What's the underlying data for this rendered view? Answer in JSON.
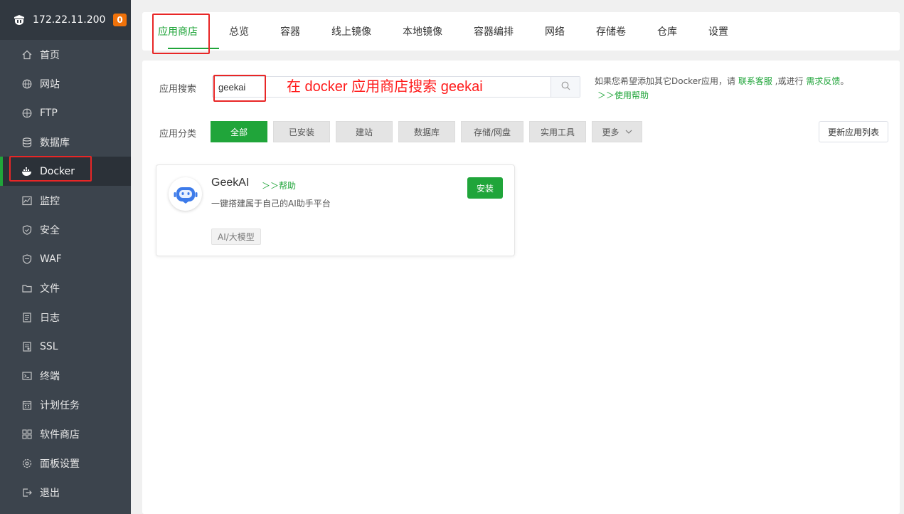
{
  "sidebar": {
    "ip": "172.22.11.200",
    "badge": "0",
    "items": [
      {
        "label": "首页",
        "icon": "home-icon"
      },
      {
        "label": "网站",
        "icon": "globe-icon"
      },
      {
        "label": "FTP",
        "icon": "ftp-icon"
      },
      {
        "label": "数据库",
        "icon": "database-icon"
      },
      {
        "label": "Docker",
        "icon": "docker-icon"
      },
      {
        "label": "监控",
        "icon": "monitor-icon"
      },
      {
        "label": "安全",
        "icon": "shield-icon"
      },
      {
        "label": "WAF",
        "icon": "waf-icon"
      },
      {
        "label": "文件",
        "icon": "folder-icon"
      },
      {
        "label": "日志",
        "icon": "log-icon"
      },
      {
        "label": "SSL",
        "icon": "ssl-icon"
      },
      {
        "label": "终端",
        "icon": "terminal-icon"
      },
      {
        "label": "计划任务",
        "icon": "calendar-icon"
      },
      {
        "label": "软件商店",
        "icon": "apps-icon"
      },
      {
        "label": "面板设置",
        "icon": "gear-icon"
      },
      {
        "label": "退出",
        "icon": "logout-icon"
      }
    ],
    "active": "Docker"
  },
  "tabs": [
    "应用商店",
    "总览",
    "容器",
    "线上镜像",
    "本地镜像",
    "容器编排",
    "网络",
    "存储卷",
    "仓库",
    "设置"
  ],
  "search": {
    "label": "应用搜索",
    "value": "geekai",
    "annotation": "在 docker 应用商店搜索 geekai",
    "hint_prefix": "如果您希望添加其它Docker应用，请 ",
    "hint_link1": "联系客服",
    "hint_mid": " ,或进行 ",
    "hint_link2": "需求反馈",
    "hint_suffix": "。",
    "help_link": "＞＞使用帮助"
  },
  "categories": {
    "label": "应用分类",
    "items": [
      "全部",
      "已安装",
      "建站",
      "数据库",
      "存储/网盘",
      "实用工具",
      "更多"
    ],
    "active": "全部",
    "refresh_label": "更新应用列表"
  },
  "app": {
    "name": "GeekAI",
    "help": "＞＞帮助",
    "desc": "一键搭建属于自己的AI助手平台",
    "install": "安装",
    "tag": "AI/大模型"
  },
  "colors": {
    "accent": "#20a53a",
    "sidebar_bg": "#3c444d",
    "badge": "#f0720a",
    "annotation": "#e82626"
  }
}
